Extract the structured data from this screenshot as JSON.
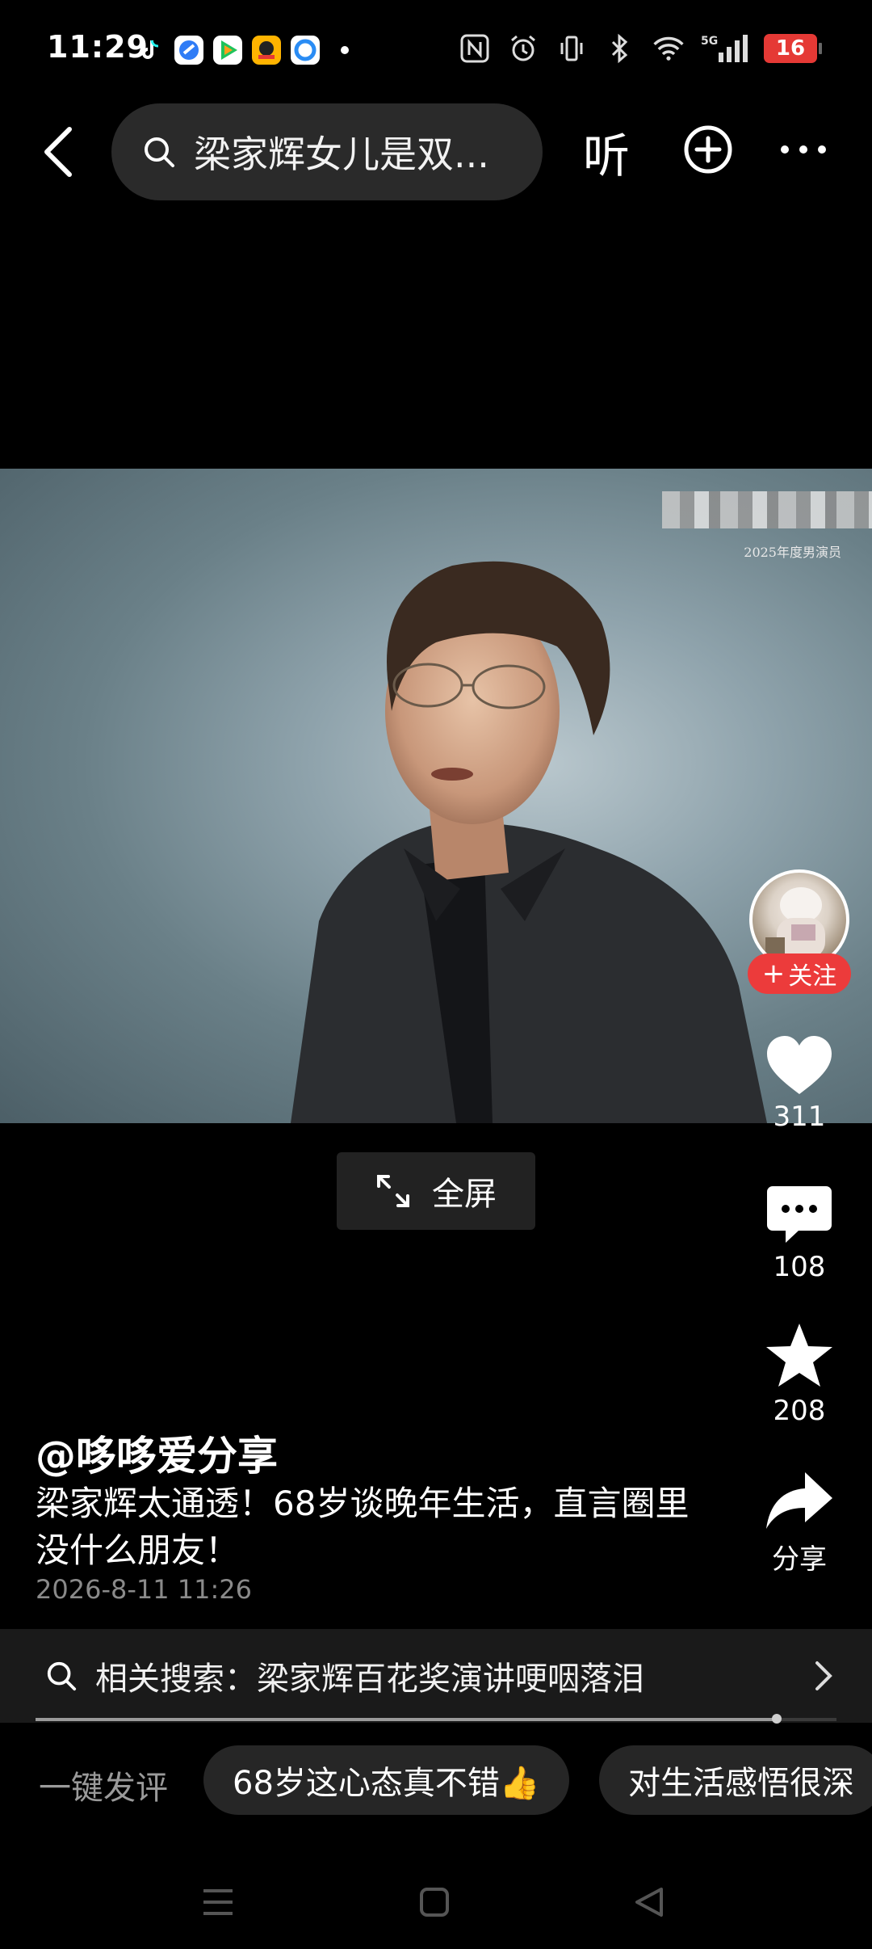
{
  "status": {
    "time": "11:29",
    "battery": "16",
    "app_icons": [
      "tiktok-icon",
      "browser-icon",
      "video-app-icon",
      "reader-app-icon",
      "cloud-app-icon"
    ],
    "system_icons": [
      "nfc-icon",
      "alarm-icon",
      "vibrate-icon",
      "bluetooth-icon",
      "wifi-icon",
      "5g-signal-icon"
    ]
  },
  "topbar": {
    "search_text": "梁家辉女儿是双...",
    "listen_label": "听"
  },
  "video": {
    "watermark_sub": "2025年度男演员",
    "fullscreen_label": "全屏"
  },
  "rail": {
    "follow_label": "关注",
    "likes": "311",
    "comments": "108",
    "favorites": "208",
    "share_label": "分享"
  },
  "post": {
    "author": "@哆哆爱分享",
    "description": "梁家辉太通透！68岁谈晚年生活，直言圈里没什么朋友！",
    "time": "2026-8-11 11:26"
  },
  "related": {
    "text": "相关搜索：梁家辉百花奖演讲哽咽落泪"
  },
  "playback": {
    "progress": 0.925
  },
  "quick_comment": {
    "label": "一键发评",
    "chips": [
      "68岁这心态真不错👍",
      "对生活感悟很深"
    ]
  },
  "colors": {
    "accent_red": "#ec3b3b",
    "background": "#000000",
    "chip_bg": "#262626"
  }
}
